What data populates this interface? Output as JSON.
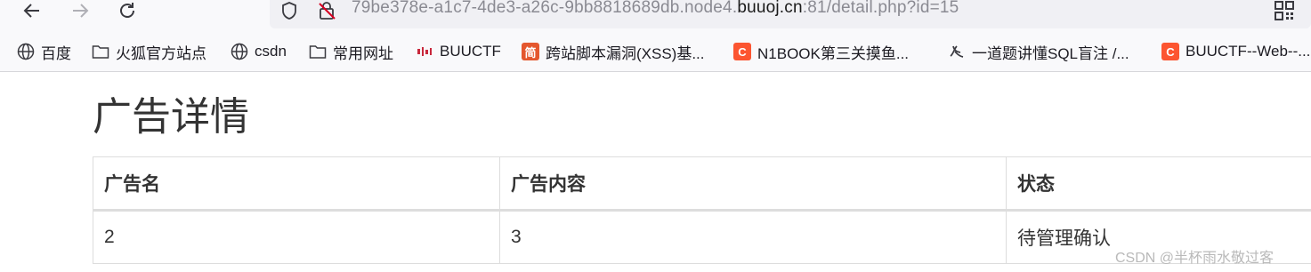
{
  "browser": {
    "url_prefix": "79be378e-a1c7-4de3-a26c-9bb8818689db.node4.",
    "url_host": "buuoj.cn",
    "url_suffix": ":81/detail.php?id=15"
  },
  "bookmarks": [
    {
      "label": "百度",
      "icon": "globe-icon"
    },
    {
      "label": "火狐官方站点",
      "icon": "folder-icon"
    },
    {
      "label": "csdn",
      "icon": "globe-icon"
    },
    {
      "label": "常用网址",
      "icon": "folder-icon"
    },
    {
      "label": "BUUCTF",
      "icon": "buuctf-logo-icon"
    },
    {
      "label": "跨站脚本漏洞(XSS)基...",
      "icon": "jian-icon",
      "icon_text": "简",
      "color": "#e4572e"
    },
    {
      "label": "N1BOOK第三关摸鱼...",
      "icon": "csdn-c-icon",
      "icon_text": "C",
      "color": "#fc5531"
    },
    {
      "label": "一道题讲懂SQL盲注 /...",
      "icon": "hand-logo-icon"
    },
    {
      "label": "BUUCTF--Web--...",
      "icon": "csdn-c-icon",
      "icon_text": "C",
      "color": "#fc5531"
    }
  ],
  "page": {
    "title": "广告详情",
    "columns": [
      "广告名",
      "广告内容",
      "状态"
    ],
    "rows": [
      [
        "2",
        "3",
        "待管理确认"
      ]
    ]
  },
  "watermark": "CSDN @半杯雨水敬过客"
}
